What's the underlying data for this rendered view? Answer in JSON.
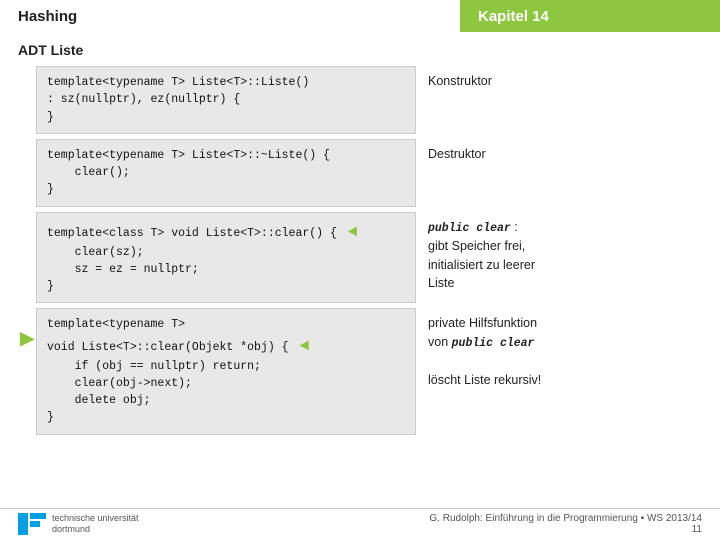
{
  "header": {
    "left_label": "Hashing",
    "right_label": "Kapitel 14"
  },
  "page": {
    "title": "ADT Liste"
  },
  "sections": [
    {
      "id": "constructor",
      "code_lines": [
        "template<typename T> Liste<T>::Liste()",
        ": sz(nullptr), ez(nullptr) {",
        "}"
      ],
      "label": "Konstruktor",
      "label_sub": "",
      "has_arrow_right": false,
      "has_arrow_left": false
    },
    {
      "id": "destructor",
      "code_lines": [
        "template<typename T> Liste<T>::~Liste() {",
        "    clear();",
        "}"
      ],
      "label": "Destruktor",
      "label_sub": "",
      "has_arrow_right": false,
      "has_arrow_left": false
    },
    {
      "id": "clear",
      "code_lines": [
        "template<class T> void Liste<T>::clear() {",
        "    clear(sz);",
        "    sz = ez = nullptr;",
        "}"
      ],
      "label_parts": [
        {
          "type": "code",
          "text": "public clear"
        },
        {
          "type": "text",
          "text": " :"
        }
      ],
      "label_lines": [
        "gibt Speicher frei,",
        "initialisiert zu leerer",
        "Liste"
      ],
      "has_arrow_right": true,
      "has_arrow_left": false
    },
    {
      "id": "clear-helper",
      "code_lines": [
        "template<typename T>",
        "void Liste<T>::clear(Objekt *obj) {",
        "    if (obj == nullptr) return;",
        "    clear(obj->next);",
        "    delete obj;",
        "}"
      ],
      "label_lines_part1": "private Hilfsfunktion",
      "label_lines_part2_prefix": "von ",
      "label_lines_part2_code": "public clear",
      "label_lines_part3": "löscht Liste rekursiv!",
      "has_arrow_right": false,
      "has_arrow_left": true
    }
  ],
  "footer": {
    "citation": "G. Rudolph: Einführung in die Programmierung ▪ WS 2013/14",
    "page_number": "11",
    "logo_text": "technische universität\ndortmund"
  }
}
